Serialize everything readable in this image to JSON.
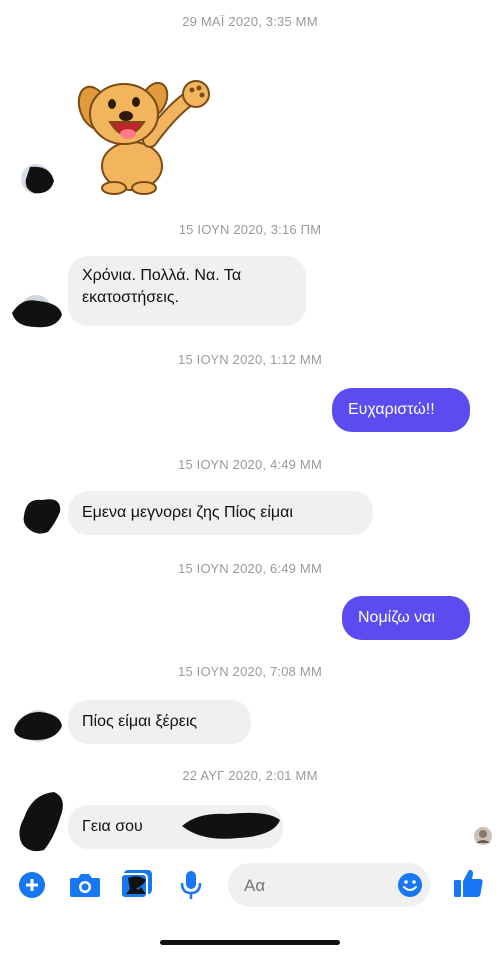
{
  "thread": {
    "timestamps": [
      "29 ΜΑΪ 2020, 3:35 ΜΜ",
      "15 ΙΟΥΝ 2020, 3:16 ΠΜ",
      "15 ΙΟΥΝ 2020, 1:12 ΜΜ",
      "15 ΙΟΥΝ 2020, 4:49 ΜΜ",
      "15 ΙΟΥΝ 2020, 6:49 ΜΜ",
      "15 ΙΟΥΝ 2020, 7:08 ΜΜ",
      "22 ΑΥΓ 2020, 2:01 ΜΜ"
    ],
    "messages": [
      {
        "direction": "incoming",
        "text": "Χρόνια. Πολλά. Να. Τα εκατοστήσεις."
      },
      {
        "direction": "outgoing",
        "text": "Ευχαριστώ!!"
      },
      {
        "direction": "incoming",
        "text": "Εμενα μεγνορει ζης Πίος είμαι"
      },
      {
        "direction": "outgoing",
        "text": "Νομίζω ναι"
      },
      {
        "direction": "incoming",
        "text": "Πίος είμαι ξέρεις"
      },
      {
        "direction": "incoming",
        "text": "Γεια  σου"
      }
    ]
  },
  "composer": {
    "placeholder": "Αα"
  },
  "icons": {
    "add": "plus-circle-icon",
    "camera": "camera-icon",
    "gallery": "photo-gallery-icon",
    "voice": "microphone-icon",
    "emoji": "emoji-icon",
    "like": "thumbs-up-icon"
  },
  "colors": {
    "outgoing_bubble": "#5b4cf0",
    "incoming_bubble": "#f0f0f0",
    "accent": "#1877f2",
    "timestamp": "#9a9a9a"
  }
}
